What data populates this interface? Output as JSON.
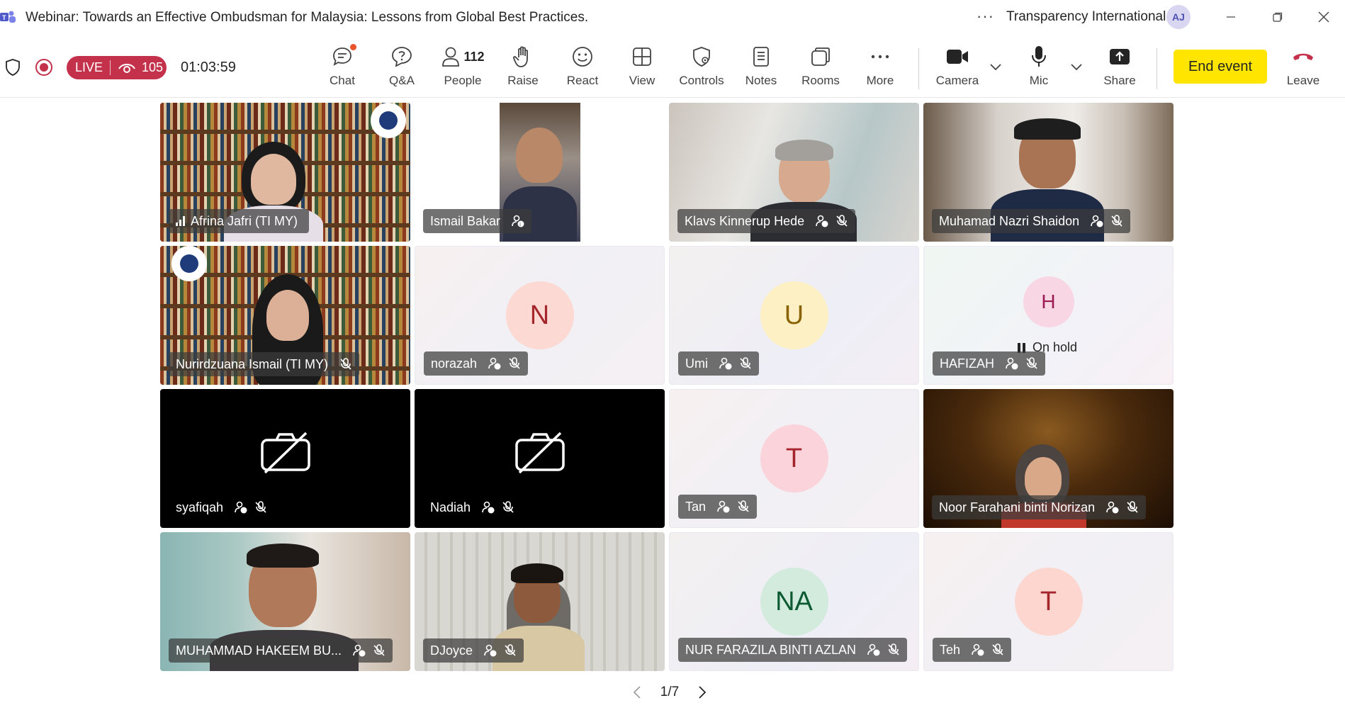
{
  "window": {
    "title": "Webinar: Towards an Effective Ombudsman for Malaysia: Lessons from Global Best Practices.",
    "org_name": "Transparency International",
    "avatar_initials": "AJ"
  },
  "status": {
    "live_label": "LIVE",
    "viewer_count": "105",
    "timer": "01:03:59"
  },
  "toolbar": {
    "chat": "Chat",
    "qa": "Q&A",
    "people": "People",
    "people_count": "112",
    "raise": "Raise",
    "react": "React",
    "view": "View",
    "controls": "Controls",
    "notes": "Notes",
    "rooms": "Rooms",
    "more": "More",
    "camera": "Camera",
    "mic": "Mic",
    "share": "Share",
    "end_event": "End event",
    "leave": "Leave"
  },
  "participants": [
    {
      "name": "Afrina Jafri (TI MY)",
      "type": "camera"
    },
    {
      "name": "Ismail Bakar",
      "type": "camera"
    },
    {
      "name": "Klavs Kinnerup Hede",
      "type": "camera"
    },
    {
      "name": "Muhamad Nazri Shaidon",
      "type": "camera"
    },
    {
      "name": "Nurirdzuana Ismail (TI MY)",
      "type": "camera"
    },
    {
      "name": "norazah",
      "type": "initial",
      "initial": "N"
    },
    {
      "name": "Umi",
      "type": "initial",
      "initial": "U"
    },
    {
      "name": "HAFIZAH",
      "type": "initial",
      "initial": "H",
      "status": "On hold"
    },
    {
      "name": "syafiqah",
      "type": "camera-off"
    },
    {
      "name": "Nadiah",
      "type": "camera-off"
    },
    {
      "name": "Tan",
      "type": "initial",
      "initial": "T"
    },
    {
      "name": "Noor Farahani binti Norizan",
      "type": "camera"
    },
    {
      "name": "MUHAMMAD HAKEEM BU...",
      "type": "camera"
    },
    {
      "name": "DJoyce",
      "type": "camera"
    },
    {
      "name": "NUR FARAZILA BINTI AZLAN",
      "type": "initial",
      "initial": "NA"
    },
    {
      "name": "Teh",
      "type": "initial",
      "initial": "T"
    }
  ],
  "pager": {
    "label": "1/7"
  },
  "colors": {
    "live_red": "#c4314b",
    "end_event_yellow": "#ffe500",
    "leave_red": "#c4314b"
  }
}
